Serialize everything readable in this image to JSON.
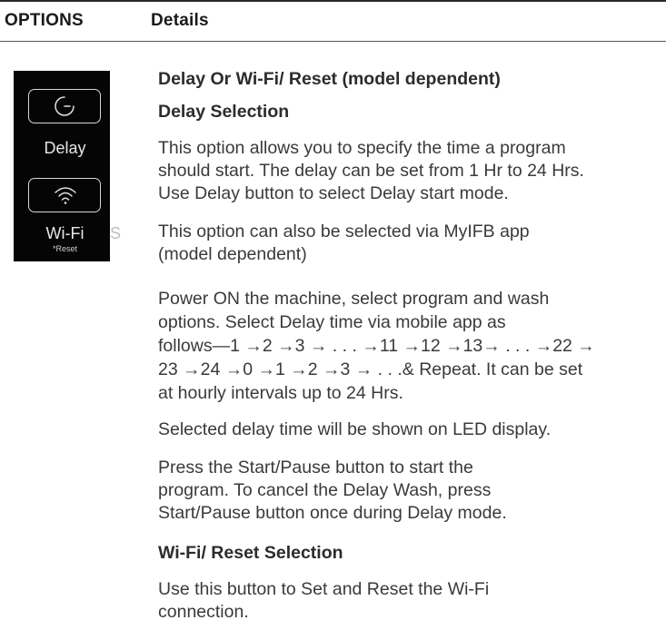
{
  "header": {
    "options_label": "OPTIONS",
    "details_label": "Details"
  },
  "panel": {
    "delay_label": "Delay",
    "wifi_label": "Wi-Fi",
    "reset_label": "*Reset",
    "edge_char": "S",
    "delay_icon": "clock-power-icon",
    "wifi_icon": "wifi-icon"
  },
  "content": {
    "title": "Delay Or Wi-Fi/ Reset (model dependent)",
    "delay_heading": "Delay Selection",
    "para1": "This option allows you to specify the time a program\nshould start. The delay can be set from 1 Hr to 24 Hrs.\nUse Delay button to select Delay start mode.",
    "para2": "This option can also be selected via MyIFB app\n(model dependent)",
    "para3": "Power ON the machine, select program and wash\noptions. Select Delay time via mobile app as\nfollows—1 →2 →3 → . . . →11 →12 →13→ . . . →22 →\n23 →24 →0 →1 →2 →3 → . . .& Repeat. It can be set\nat hourly intervals up to 24 Hrs.",
    "para4": "Selected delay time will be shown on LED display.",
    "para5": "Press the Start/Pause button to start the\nprogram. To cancel the Delay Wash, press\nStart/Pause button once during Delay mode.",
    "wifi_heading": "Wi-Fi/ Reset Selection",
    "para6": "Use this button to Set and Reset the Wi-Fi\nconnection."
  }
}
